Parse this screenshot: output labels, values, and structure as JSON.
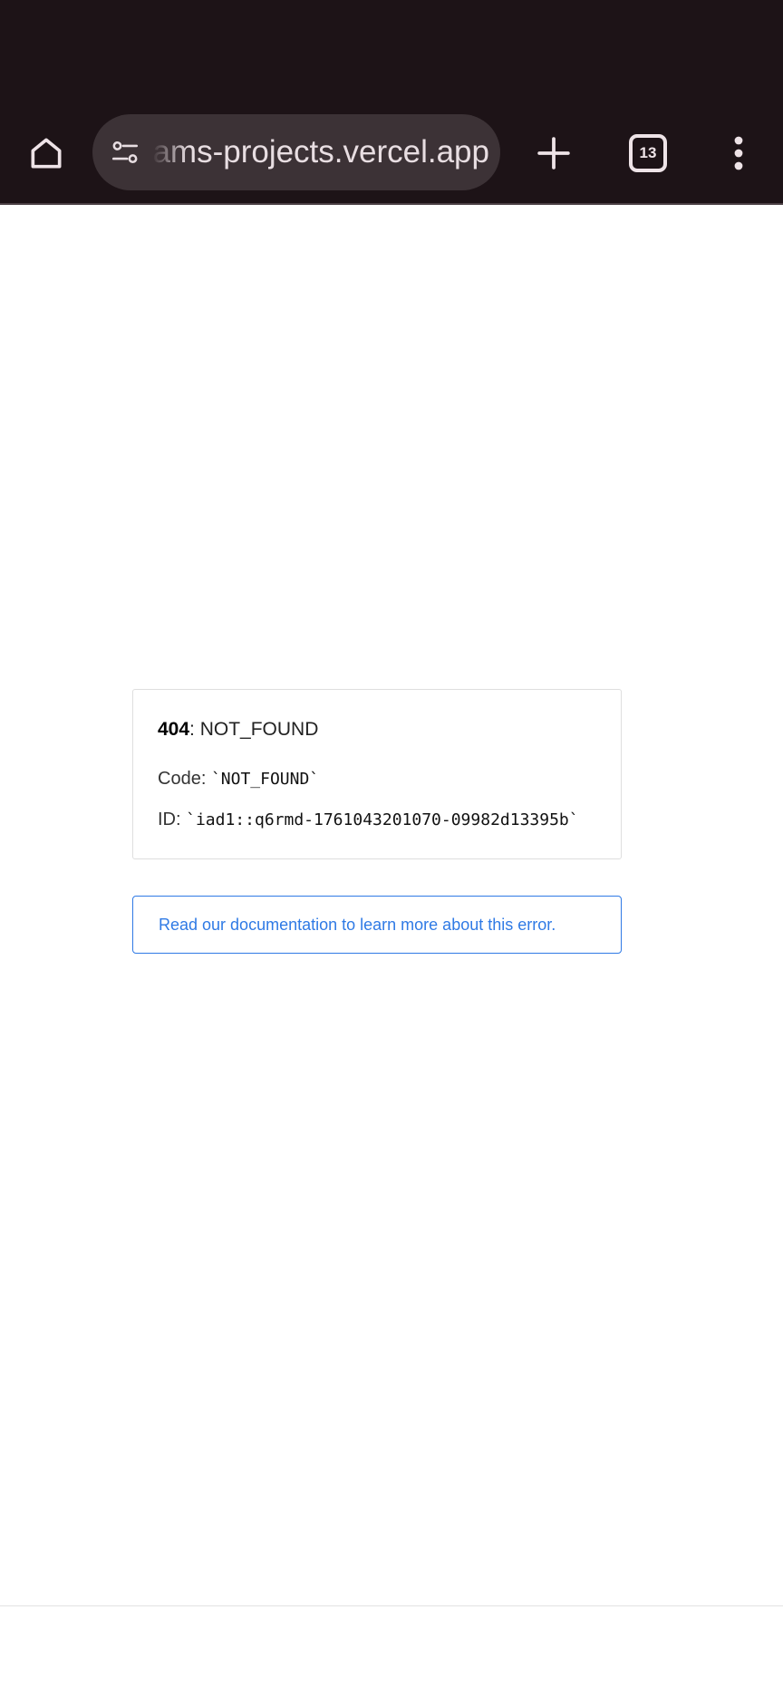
{
  "browser": {
    "url_text": "ams-projects.vercel.app",
    "tab_count": "13",
    "icons": {
      "home": "home-icon",
      "site_settings": "tune-icon",
      "new_tab": "plus-icon",
      "tabs": "tab-switcher-icon",
      "menu": "more-vertical-icon"
    },
    "colors": {
      "chrome_background": "#1d1317",
      "omnibox_background": "#3c3236"
    }
  },
  "page": {
    "status_code": "404",
    "status_text": ": NOT_FOUND",
    "code_label": "Code:",
    "code_value": "`NOT_FOUND`",
    "id_label": "ID:",
    "id_value": "`iad1::q6rmd-1761043201070-09982d13395b`",
    "doc_link_text": "Read our documentation to learn more about this error.",
    "colors": {
      "link": "#2f7ae5"
    }
  }
}
